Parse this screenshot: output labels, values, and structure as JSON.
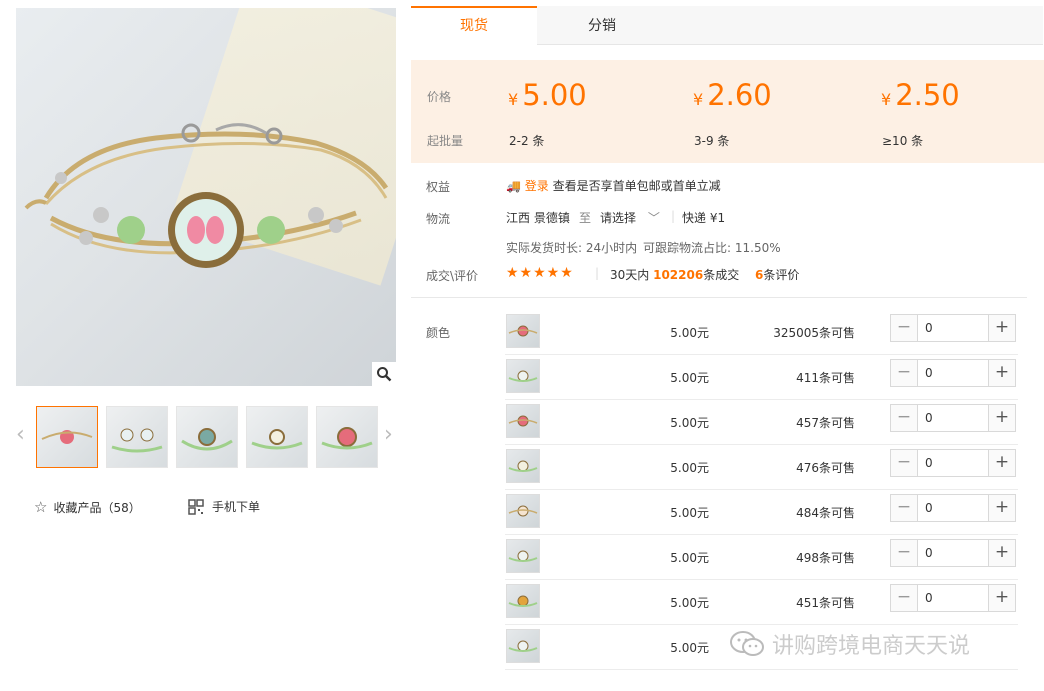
{
  "gallery": {
    "favorite_label": "收藏产品（58）",
    "mobile_order_label": "手机下单"
  },
  "tabs": [
    {
      "label": "现货",
      "active": true
    },
    {
      "label": "分销",
      "active": false
    }
  ],
  "pricing": {
    "price_label": "价格",
    "moq_label": "起批量",
    "currency": "¥",
    "tiers": [
      {
        "price": "5.00",
        "qty": "2-2 条"
      },
      {
        "price": "2.60",
        "qty": "3-9 条"
      },
      {
        "price": "2.50",
        "qty": "≥10 条"
      }
    ]
  },
  "benefits": {
    "label": "权益",
    "login_link": "登录",
    "text": "查看是否享首单包邮或首单立减"
  },
  "logistics": {
    "label": "物流",
    "origin": "江西 景德镇",
    "to": "至",
    "destination": "请选择",
    "express": "快递 ¥1",
    "ship_time": "实际发货时长: 24小时内",
    "traceable": "可跟踪物流占比: 11.50%"
  },
  "reviews": {
    "label": "成交\\评价",
    "stars": "★★★★★",
    "period": "30天内",
    "deals": "102206",
    "deals_suffix": "条成交",
    "review_count": "6",
    "review_suffix": "条评价"
  },
  "sku": {
    "label": "颜色",
    "rows": [
      {
        "price": "5.00元",
        "stock": "325005条可售",
        "qty": "0"
      },
      {
        "price": "5.00元",
        "stock": "411条可售",
        "qty": "0"
      },
      {
        "price": "5.00元",
        "stock": "457条可售",
        "qty": "0"
      },
      {
        "price": "5.00元",
        "stock": "476条可售",
        "qty": "0"
      },
      {
        "price": "5.00元",
        "stock": "484条可售",
        "qty": "0"
      },
      {
        "price": "5.00元",
        "stock": "498条可售",
        "qty": "0"
      },
      {
        "price": "5.00元",
        "stock": "451条可售",
        "qty": "0"
      },
      {
        "price": "5.00元",
        "stock": "",
        "qty": ""
      }
    ]
  },
  "watermark": "讲购跨境电商天天说",
  "colors": {
    "accent": "#ff7300",
    "price_bg": "#fdf0e4"
  }
}
